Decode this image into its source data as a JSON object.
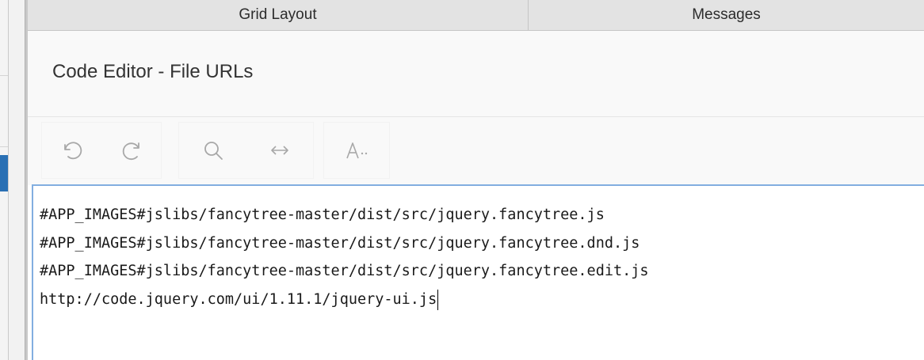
{
  "tabs": [
    {
      "label": "Grid Layout"
    },
    {
      "label": "Messages"
    }
  ],
  "dialog": {
    "title": "Code Editor - File URLs"
  },
  "toolbar": {
    "undo_icon": "undo-icon",
    "redo_icon": "redo-icon",
    "search_icon": "search-icon",
    "replace_icon": "swap-horizontal-icon",
    "font_icon": "font-settings-icon"
  },
  "editor": {
    "lines": [
      "#APP_IMAGES#jslibs/fancytree-master/dist/src/jquery.fancytree.js",
      "#APP_IMAGES#jslibs/fancytree-master/dist/src/jquery.fancytree.dnd.js",
      "#APP_IMAGES#jslibs/fancytree-master/dist/src/jquery.fancytree.edit.js",
      "http://code.jquery.com/ui/1.11.1/jquery-ui.js"
    ]
  },
  "colors": {
    "accent": "#2a70b4",
    "editor_focus_border": "#82aee0",
    "tabbar_bg": "#e3e3e3",
    "icon_gray": "#a8a8a8"
  }
}
